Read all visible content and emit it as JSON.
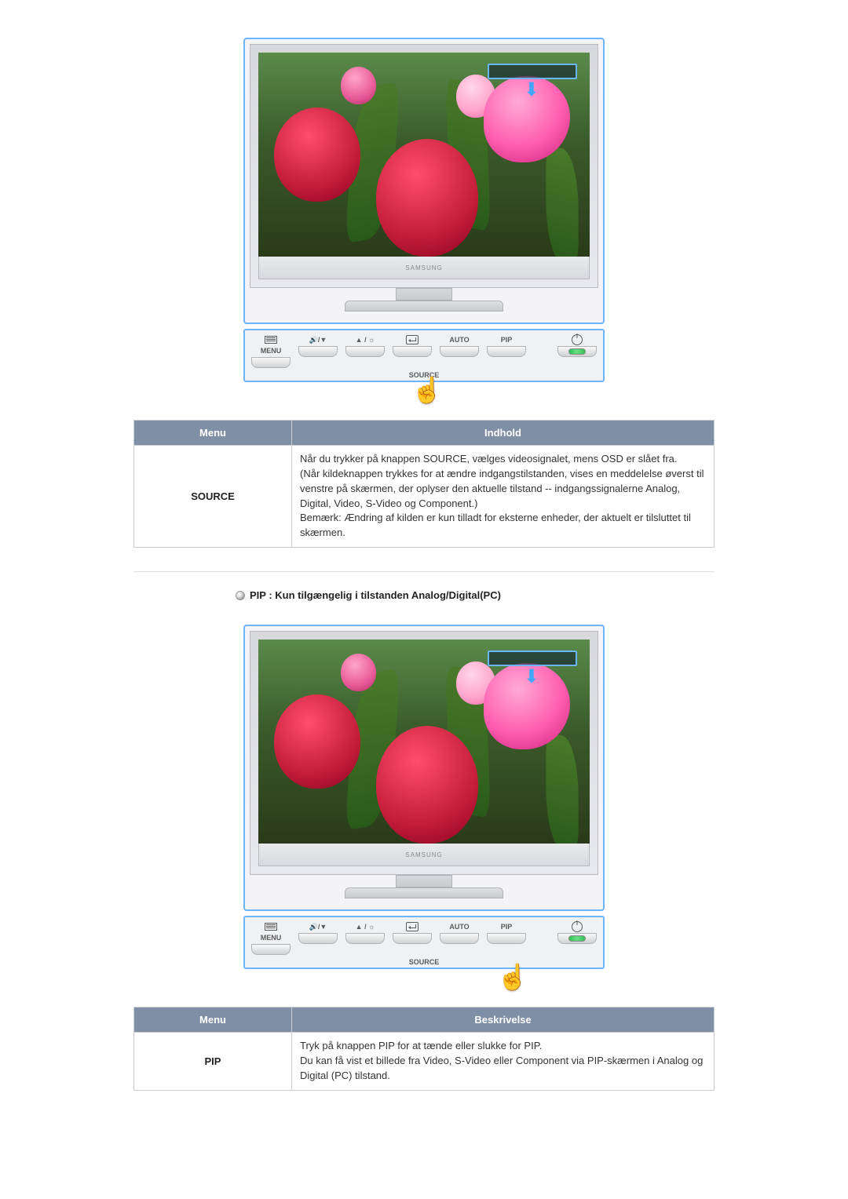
{
  "monitor": {
    "brand_label": "SAMSUNG",
    "buttons": {
      "menu": "MENU",
      "down_bri": "▼",
      "up_bri": "▲ / ☼",
      "enter": "⏎",
      "auto": "AUTO",
      "pip": "PIP",
      "source": "SOURCE",
      "power": "⏻"
    },
    "down_icons": "🔊/▼"
  },
  "source_section": {
    "headers": {
      "menu": "Menu",
      "content": "Indhold"
    },
    "row": {
      "menu": "SOURCE",
      "content": "Når du trykker på knappen SOURCE, vælges videosignalet, mens OSD er slået fra.\n(Når kildeknappen trykkes for at ændre indgangstilstanden, vises en meddelelse øverst til venstre på skærmen, der oplyser den aktuelle tilstand -- indgangssignalerne Analog, Digital, Video, S-Video og Component.)\nBemærk: Ændring af kilden er kun tilladt for eksterne enheder, der aktuelt er tilsluttet til skærmen."
    }
  },
  "pip_section": {
    "heading": "PIP  : Kun tilgængelig i tilstanden Analog/Digital(PC)",
    "headers": {
      "menu": "Menu",
      "content": "Beskrivelse"
    },
    "row": {
      "menu": "PIP",
      "content": "Tryk på knappen PIP for at tænde eller slukke for PIP.\nDu kan få vist et billede fra Video, S-Video eller Component via PIP-skærmen i Analog og Digital (PC) tilstand."
    }
  }
}
